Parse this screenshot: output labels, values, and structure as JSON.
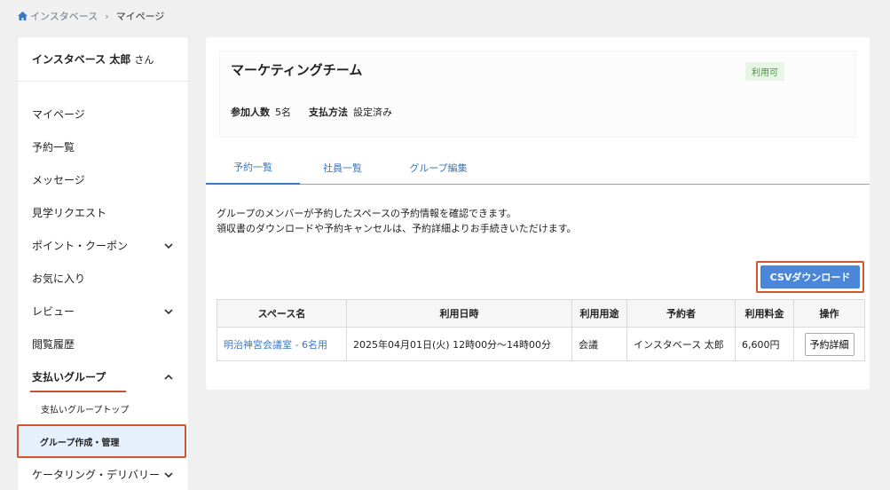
{
  "breadcrumb": {
    "home": "インスタベース",
    "current": "マイページ"
  },
  "sidebar": {
    "user_name": "インスタベース 太郎",
    "user_suffix": "さん",
    "items": [
      {
        "label": "マイページ"
      },
      {
        "label": "予約一覧"
      },
      {
        "label": "メッセージ"
      },
      {
        "label": "見学リクエスト"
      },
      {
        "label": "ポイント・クーポン"
      },
      {
        "label": "お気に入り"
      },
      {
        "label": "レビュー"
      },
      {
        "label": "閲覧履歴"
      },
      {
        "label": "支払いグループ"
      },
      {
        "label": "ケータリング・デリバリー"
      }
    ],
    "sub_items": [
      {
        "label": "支払いグループトップ"
      },
      {
        "label": "グループ作成・管理"
      }
    ]
  },
  "group": {
    "title": "マーケティングチーム",
    "status": "利用可",
    "members_label": "参加人数",
    "members_value": "5名",
    "payment_label": "支払方法",
    "payment_value": "設定済み"
  },
  "tabs": [
    {
      "label": "予約一覧"
    },
    {
      "label": "社員一覧"
    },
    {
      "label": "グループ編集"
    }
  ],
  "description": {
    "line1": "グループのメンバーが予約したスペースの予約情報を確認できます。",
    "line2": "領収書のダウンロードや予約キャンセルは、予約詳細よりお手続きいただけます。"
  },
  "csv_button": "CSVダウンロード",
  "table": {
    "headers": [
      "スペース名",
      "利用日時",
      "利用用途",
      "予約者",
      "利用料金",
      "操作"
    ],
    "rows": [
      {
        "space": "明治神宮会議室 - 6名用",
        "datetime": "2025年04月01日(火) 12時00分〜14時00分",
        "purpose": "会議",
        "booker": "インスタベース 太郎",
        "fee": "6,600円",
        "action": "予約詳細"
      }
    ]
  },
  "colors": {
    "accent": "#3a78c2",
    "highlight": "#d2552e",
    "status_green": "#3c9a3a"
  }
}
